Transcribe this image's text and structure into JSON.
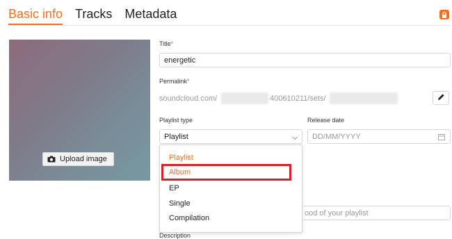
{
  "tabs": [
    {
      "label": "Basic info",
      "active": true
    },
    {
      "label": "Tracks",
      "active": false
    },
    {
      "label": "Metadata",
      "active": false
    }
  ],
  "artwork": {
    "upload_label": "Upload image"
  },
  "title_field": {
    "label": "Title",
    "required_mark": "*",
    "value": "energetic"
  },
  "permalink": {
    "label": "Permalink",
    "required_mark": "*",
    "prefix": "soundcloud.com/",
    "mid": "400610211/sets/"
  },
  "playlist_type": {
    "label": "Playlist type",
    "value": "Playlist"
  },
  "release_date": {
    "label": "Release date",
    "placeholder": "DD/MM/YYYY"
  },
  "dropdown": {
    "options": [
      "Playlist",
      "Album",
      "EP",
      "Single",
      "Compilation"
    ],
    "selected": "Playlist",
    "highlighted": "Album"
  },
  "mood_field": {
    "partial_placeholder": "ood of your playlist"
  },
  "description": {
    "label": "Description"
  },
  "colors": {
    "accent": "#f26f23",
    "highlight": "#d8202b"
  },
  "icons": [
    "lock-icon",
    "camera-icon",
    "pencil-icon",
    "chevron-down-icon",
    "calendar-icon"
  ]
}
